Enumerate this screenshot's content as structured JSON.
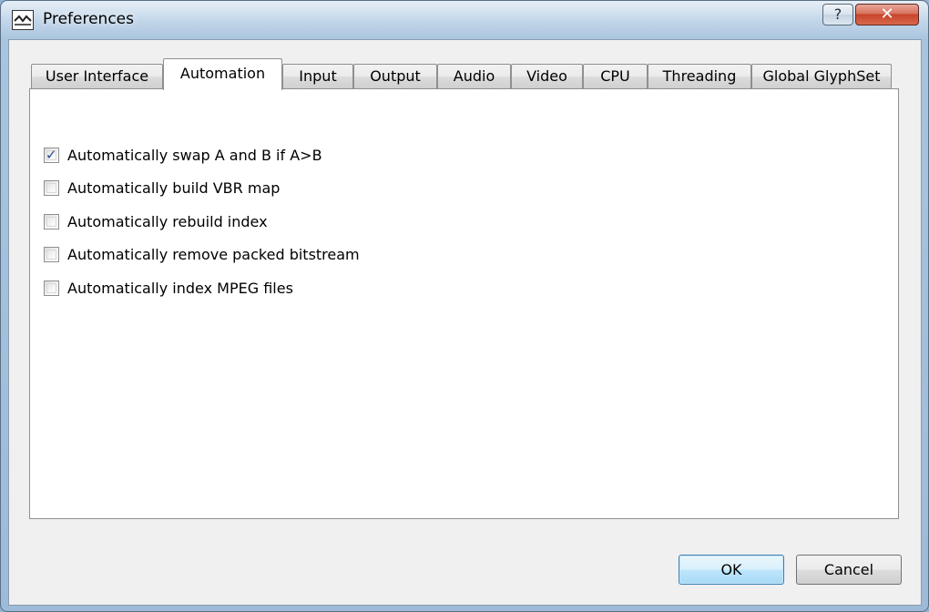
{
  "window": {
    "title": "Preferences",
    "help_label": "?",
    "close_label": "✕"
  },
  "tabs": [
    {
      "label": "User Interface"
    },
    {
      "label": "Automation"
    },
    {
      "label": "Input"
    },
    {
      "label": "Output"
    },
    {
      "label": "Audio"
    },
    {
      "label": "Video"
    },
    {
      "label": "CPU"
    },
    {
      "label": "Threading"
    },
    {
      "label": "Global GlyphSet"
    }
  ],
  "active_tab": "Automation",
  "options": [
    {
      "label": "Automatically swap A and B if A>B",
      "checked": true,
      "mark": "✓"
    },
    {
      "label": "Automatically build VBR map",
      "checked": false,
      "mark": ""
    },
    {
      "label": "Automatically rebuild index",
      "checked": false,
      "mark": ""
    },
    {
      "label": "Automatically remove packed bitstream",
      "checked": false,
      "mark": ""
    },
    {
      "label": "Automatically index MPEG files",
      "checked": false,
      "mark": ""
    }
  ],
  "buttons": {
    "ok_label": "OK",
    "cancel_label": "Cancel"
  }
}
